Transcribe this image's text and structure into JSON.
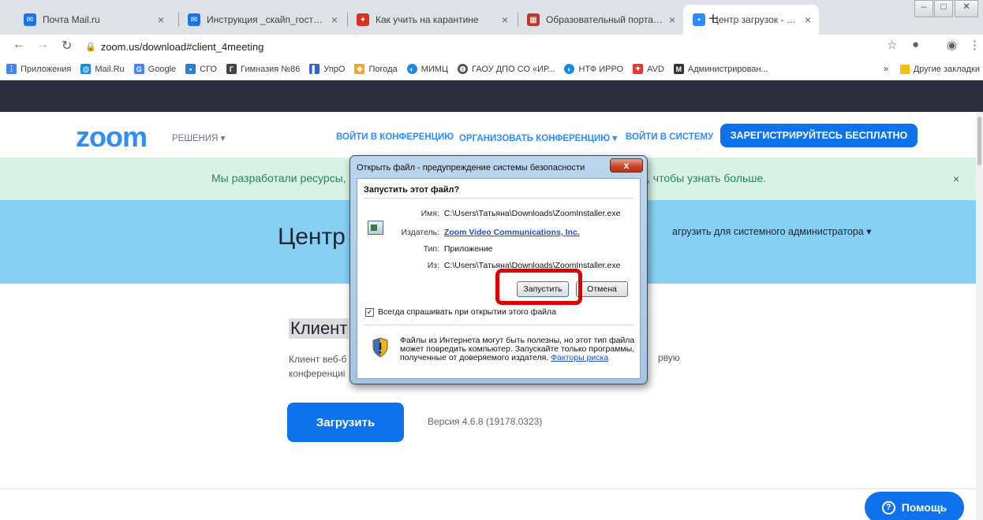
{
  "browser": {
    "tabs": [
      {
        "title": "Почта Mail.ru",
        "color": "#1a73e8"
      },
      {
        "title": "Инструкция _скайп_гость.pdf -",
        "color": "#1a73e8"
      },
      {
        "title": "Как учить на карантине",
        "color": "#d93025"
      },
      {
        "title": "Образовательный портал на б",
        "color": "#b7392e"
      },
      {
        "title": "Центр загрузок - Zoom",
        "color": "#2d8cff"
      }
    ],
    "new_tab": "+",
    "url": "zoom.us/download#client_4meeting",
    "bookmarks": [
      {
        "label": "Приложения",
        "color": "#4285f4"
      },
      {
        "label": "Mail.Ru",
        "color": "#168de2"
      },
      {
        "label": "Google",
        "color": "#4285f4"
      },
      {
        "label": "СГО",
        "color": "#2a7fd4"
      },
      {
        "label": "Гимназия №86",
        "color": "#444444"
      },
      {
        "label": "УпрО",
        "color": "#3366cc"
      },
      {
        "label": "Погода",
        "color": "#f5a623"
      },
      {
        "label": "МИМЦ",
        "color": "#1e88e5"
      },
      {
        "label": "ГАОУ ДПО СО «ИР...",
        "color": "#555555"
      },
      {
        "label": "НТФ ИРРО",
        "color": "#1e88e5"
      },
      {
        "label": "AVD",
        "color": "#e53935"
      },
      {
        "label": "Администрирован...",
        "color": "#333333"
      }
    ],
    "bookmarks_more": "»",
    "other_bookmarks": "Другие закладки"
  },
  "zoom": {
    "logo": "zoom",
    "nav": {
      "solutions": "РЕШЕНИЯ ▾",
      "join": "ВОЙТИ В КОНФЕРЕНЦИЮ",
      "host": "ОРГАНИЗОВАТЬ КОНФЕРЕНЦИЮ ▾",
      "signin": "ВОЙТИ В СИСТЕМУ",
      "signup": "ЗАРЕГИСТРИРУЙТЕСЬ БЕСПЛАТНО"
    },
    "banner_text_left": "Мы разработали ресурсы,",
    "banner_text_right": ", чтобы узнать больше.",
    "banner_close": "×",
    "hero_title": "Центр",
    "admin_link": "агрузить для системного администратора ▾",
    "section_title": "Клиент",
    "section_desc_1": "Клиент веб-б",
    "section_desc_2": "конференциі",
    "section_desc_right": "рвую",
    "download_button": "Загрузить",
    "version": "Версия 4.6.8 (19178.0323)",
    "help_button": "Помощь"
  },
  "dialog": {
    "title": "Открыть файл - предупреждение системы безопасности",
    "close": "x",
    "heading": "Запустить этот файл?",
    "rows": [
      {
        "key": "Имя:",
        "value": "C:\\Users\\Татьяна\\Downloads\\ZoomInstaller.exe"
      },
      {
        "key": "Издатель:",
        "value": "Zoom Video Communications, Inc."
      },
      {
        "key": "Тип:",
        "value": "Приложение"
      },
      {
        "key": "Из:",
        "value": "C:\\Users\\Татьяна\\Downloads\\ZoomInstaller.exe"
      }
    ],
    "run_button": "Запустить",
    "cancel_button": "Отмена",
    "checkbox_checked": true,
    "checkbox_label": "Всегда спрашивать при открытии этого файла",
    "warning_text": "Файлы из Интернета могут быть полезны, но этот тип файла может повредить компьютер. Запускайте только программы, полученные от доверяемого издателя.",
    "risk_link": "Факторы риска"
  }
}
